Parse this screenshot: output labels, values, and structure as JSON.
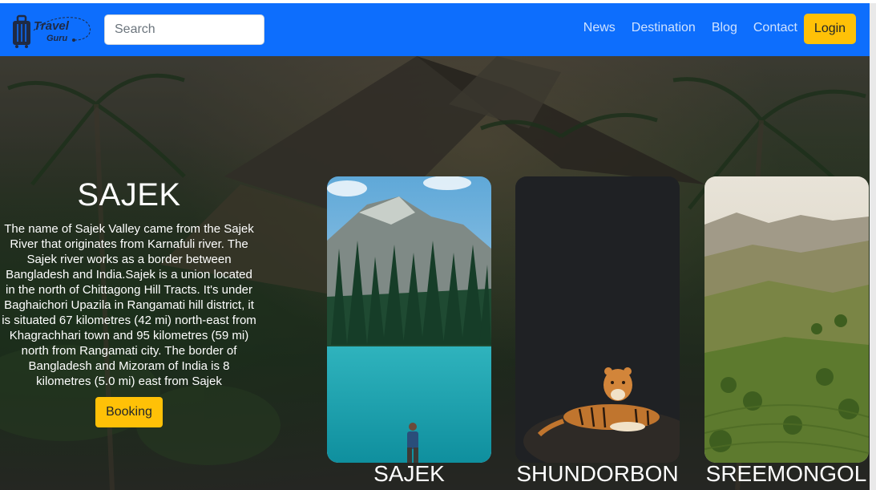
{
  "brand": {
    "line1": "Travel",
    "line2": "Guru"
  },
  "search": {
    "placeholder": "Search"
  },
  "nav": {
    "links": [
      "News",
      "Destination",
      "Blog",
      "Contact"
    ],
    "login_label": "Login"
  },
  "hero": {
    "title": "SAJEK",
    "description": "The name of Sajek Valley came from the Sajek River that originates from Karnafuli river. The Sajek river works as a border between Bangladesh and India.Sajek is a union located in the north of Chittagong Hill Tracts. It's under Baghaichori Upazila in Rangamati hill district, it is situated 67 kilometres (42 mi) north-east from Khagrachhari town and 95 kilometres (59 mi) north from Rangamati city. The border of Bangladesh and Mizoram of India is 8 kilometres (5.0 mi) east from Sajek",
    "booking_label": "Booking"
  },
  "destinations": [
    {
      "name": "SAJEK",
      "image": "lake-mountain-hiker"
    },
    {
      "name": "SHUNDORBON",
      "image": "tiger-resting"
    },
    {
      "name": "SREEMONGOL",
      "image": "tea-garden-hills"
    }
  ],
  "colors": {
    "nav_bg": "#0d6efd",
    "accent": "#ffc107",
    "link": "#cfe2ff"
  }
}
